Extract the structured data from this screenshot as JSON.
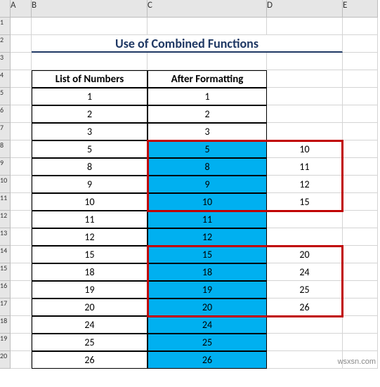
{
  "columns": [
    "",
    "A",
    "B",
    "C",
    "D",
    "E"
  ],
  "title": "Use of Combined Functions",
  "headers": {
    "b": "List of Numbers",
    "c": "After Formatting"
  },
  "rows": [
    {
      "r": 1
    },
    {
      "r": 2
    },
    {
      "r": 3
    },
    {
      "r": 4
    },
    {
      "r": 5,
      "b": "1",
      "c": "1"
    },
    {
      "r": 6,
      "b": "2",
      "c": "2"
    },
    {
      "r": 7,
      "b": "3",
      "c": "3"
    },
    {
      "r": 8,
      "b": "5",
      "c": "5",
      "d": "10",
      "hl": true
    },
    {
      "r": 9,
      "b": "8",
      "c": "8",
      "d": "11",
      "hl": true
    },
    {
      "r": 10,
      "b": "9",
      "c": "9",
      "d": "12",
      "hl": true
    },
    {
      "r": 11,
      "b": "10",
      "c": "10",
      "d": "15",
      "hl": true
    },
    {
      "r": 12,
      "b": "11",
      "c": "11",
      "hl": true
    },
    {
      "r": 13,
      "b": "12",
      "c": "12",
      "hl": true
    },
    {
      "r": 14,
      "b": "15",
      "c": "15",
      "d": "20",
      "hl": true
    },
    {
      "r": 15,
      "b": "18",
      "c": "18",
      "d": "24",
      "hl": true
    },
    {
      "r": 16,
      "b": "19",
      "c": "19",
      "d": "25",
      "hl": true
    },
    {
      "r": 17,
      "b": "20",
      "c": "20",
      "d": "26",
      "hl": true
    },
    {
      "r": 18,
      "b": "24",
      "c": "24",
      "hl": true
    },
    {
      "r": 19,
      "b": "25",
      "c": "25",
      "hl": true
    },
    {
      "r": 20,
      "b": "26",
      "c": "26",
      "hl": true
    }
  ],
  "watermark": "wsxsn.com"
}
